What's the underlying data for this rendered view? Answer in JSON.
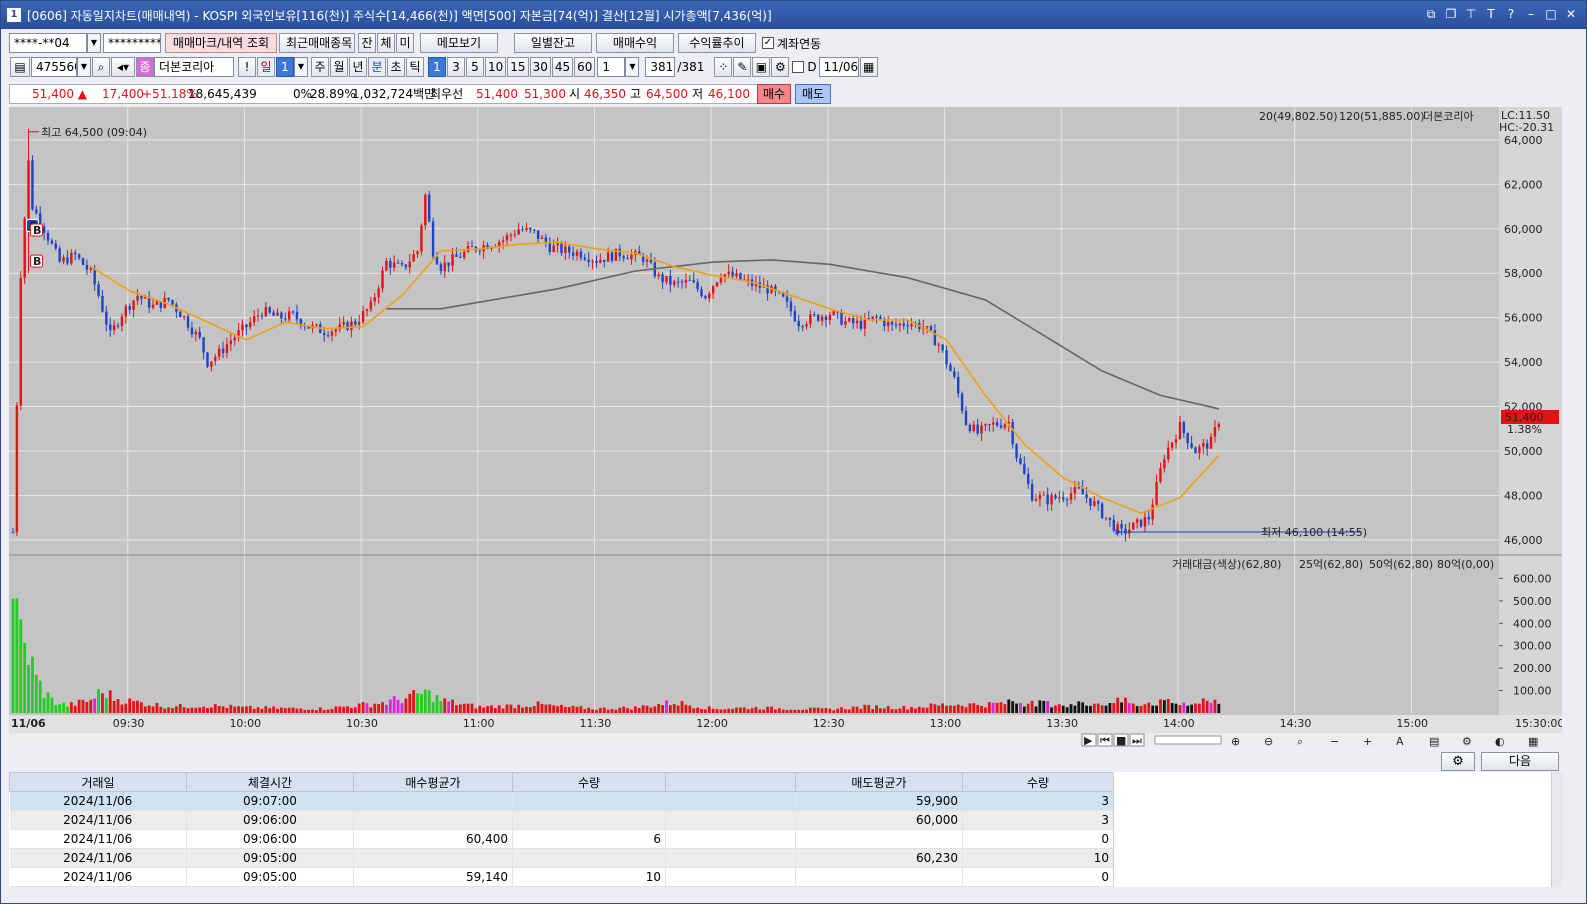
{
  "window": {
    "title": "[0606] 자동일지차트(매매내역) - KOSPI 외국인보유[116(천)] 주식수[14,466(천)] 액면[500] 자본금[74(억)] 결산[12월] 시가총액[7,436(억)]",
    "icon": "1"
  },
  "toolbar1": {
    "account": "****-**04",
    "password": "*********",
    "mark_query": "매매마크/내역 조회",
    "recent": "최근매매종목",
    "tabs": [
      "잔",
      "체",
      "미"
    ],
    "memo": "메모보기",
    "daily": "일별잔고",
    "profit": "매매수익",
    "return": "수익률추이",
    "link_label": "계좌연동"
  },
  "toolbar2": {
    "code": "475560",
    "name": "더본코리아",
    "name_icon": "종",
    "period_label": "일",
    "period_value": "1",
    "periods": [
      "주",
      "월",
      "년",
      "분",
      "초",
      "틱"
    ],
    "minutes": [
      "1",
      "3",
      "5",
      "10",
      "15",
      "30",
      "45",
      "60"
    ],
    "unit_value": "1",
    "count": "381",
    "total": "/381",
    "date_prefix": "D",
    "date": "11/06"
  },
  "quote": {
    "price": "51,400 ▲",
    "change": "17,400",
    "rate": "+51.18%",
    "volume": "18,645,439",
    "pct0": "0%",
    "turnover": "28.89%",
    "amount": "1,032,724백만",
    "best_label": "최우선",
    "ask": "51,400",
    "bid": "51,300",
    "open_label": "시",
    "open": "46,350",
    "high_label": "고",
    "high": "64,500",
    "low_label": "저",
    "low": "46,100",
    "buy": "매수",
    "sell": "매도"
  },
  "chart_data": {
    "type": "candlestick",
    "legend": {
      "ma20": "20(49,802.50)",
      "ma120": "120(51,885.00)",
      "name": "더본코리아",
      "lc": "LC:11.50",
      "hc": "HC:-20.31"
    },
    "colors": {
      "up": "#e01414",
      "down": "#1d44c8",
      "ma20": "#f0a010",
      "ma120": "#666666"
    },
    "y_ticks": [
      "64,000",
      "62,000",
      "60,000",
      "58,000",
      "56,000",
      "54,000",
      "52,000",
      "50,000",
      "48,000",
      "46,000"
    ],
    "ylim": [
      45500,
      65300
    ],
    "current_price": "51,400",
    "current_rate": "1.38%",
    "high_note": "최고 64,500 (09:04)",
    "low_note": "최저 46,100 (14:55)",
    "x_ticks": [
      "11/06",
      "09:30",
      "10:00",
      "10:30",
      "11:00",
      "11:30",
      "12:00",
      "12:30",
      "13:00",
      "13:30",
      "14:00",
      "14:30",
      "15:00",
      "15:30:00"
    ],
    "close_path": [
      [
        0,
        46350
      ],
      [
        2,
        58000
      ],
      [
        4,
        63000
      ],
      [
        5,
        61000
      ],
      [
        8,
        60000
      ],
      [
        12,
        58500
      ],
      [
        16,
        58800
      ],
      [
        20,
        58000
      ],
      [
        22,
        57000
      ],
      [
        25,
        55200
      ],
      [
        28,
        56200
      ],
      [
        32,
        57000
      ],
      [
        36,
        56500
      ],
      [
        40,
        56800
      ],
      [
        44,
        56000
      ],
      [
        48,
        55000
      ],
      [
        50,
        54000
      ],
      [
        53,
        54400
      ],
      [
        56,
        55000
      ],
      [
        60,
        55600
      ],
      [
        64,
        56300
      ],
      [
        68,
        56000
      ],
      [
        72,
        56100
      ],
      [
        76,
        55600
      ],
      [
        80,
        55400
      ],
      [
        84,
        55500
      ],
      [
        88,
        55800
      ],
      [
        92,
        56500
      ],
      [
        96,
        58500
      ],
      [
        100,
        58200
      ],
      [
        104,
        59000
      ],
      [
        106,
        61500
      ],
      [
        108,
        59000
      ],
      [
        110,
        58300
      ],
      [
        114,
        58700
      ],
      [
        118,
        59100
      ],
      [
        122,
        59300
      ],
      [
        126,
        59500
      ],
      [
        130,
        60000
      ],
      [
        134,
        59800
      ],
      [
        138,
        59200
      ],
      [
        142,
        59000
      ],
      [
        146,
        58900
      ],
      [
        150,
        58600
      ],
      [
        156,
        58900
      ],
      [
        162,
        58700
      ],
      [
        166,
        57800
      ],
      [
        170,
        57500
      ],
      [
        174,
        57600
      ],
      [
        178,
        57000
      ],
      [
        182,
        58000
      ],
      [
        186,
        57800
      ],
      [
        190,
        57500
      ],
      [
        194,
        57300
      ],
      [
        198,
        56800
      ],
      [
        202,
        55800
      ],
      [
        206,
        56000
      ],
      [
        210,
        56200
      ],
      [
        214,
        55800
      ],
      [
        218,
        55700
      ],
      [
        222,
        56000
      ],
      [
        226,
        55600
      ],
      [
        230,
        55800
      ],
      [
        234,
        55600
      ],
      [
        238,
        54800
      ],
      [
        242,
        53200
      ],
      [
        245,
        51300
      ],
      [
        248,
        50800
      ],
      [
        252,
        51200
      ],
      [
        256,
        51300
      ],
      [
        258,
        49800
      ],
      [
        262,
        48000
      ],
      [
        266,
        47800
      ],
      [
        270,
        48000
      ],
      [
        274,
        48200
      ],
      [
        278,
        47600
      ],
      [
        282,
        46800
      ],
      [
        285,
        46300
      ],
      [
        288,
        46600
      ],
      [
        292,
        47000
      ],
      [
        296,
        49800
      ],
      [
        300,
        51100
      ],
      [
        304,
        50000
      ],
      [
        308,
        50400
      ],
      [
        310,
        51400
      ]
    ],
    "ma20": [
      [
        20,
        58300
      ],
      [
        30,
        57200
      ],
      [
        40,
        56600
      ],
      [
        50,
        55800
      ],
      [
        60,
        55000
      ],
      [
        70,
        55800
      ],
      [
        80,
        55500
      ],
      [
        90,
        55600
      ],
      [
        100,
        57000
      ],
      [
        110,
        59000
      ],
      [
        120,
        59100
      ],
      [
        130,
        59300
      ],
      [
        140,
        59400
      ],
      [
        150,
        59100
      ],
      [
        160,
        58900
      ],
      [
        170,
        58300
      ],
      [
        180,
        57900
      ],
      [
        190,
        57600
      ],
      [
        200,
        57000
      ],
      [
        210,
        56400
      ],
      [
        220,
        55900
      ],
      [
        230,
        55900
      ],
      [
        240,
        55000
      ],
      [
        250,
        52500
      ],
      [
        260,
        50300
      ],
      [
        270,
        48800
      ],
      [
        280,
        47900
      ],
      [
        290,
        47200
      ],
      [
        300,
        47900
      ],
      [
        310,
        49800
      ]
    ],
    "ma120": [
      [
        96,
        56400
      ],
      [
        110,
        56400
      ],
      [
        120,
        56700
      ],
      [
        140,
        57300
      ],
      [
        160,
        58100
      ],
      [
        180,
        58500
      ],
      [
        195,
        58600
      ],
      [
        210,
        58400
      ],
      [
        230,
        57800
      ],
      [
        250,
        56800
      ],
      [
        265,
        55200
      ],
      [
        280,
        53600
      ],
      [
        295,
        52500
      ],
      [
        310,
        51900
      ]
    ],
    "trade_marks": [
      {
        "label": "S",
        "price": 60100
      },
      {
        "label": "B",
        "price": 59900
      },
      {
        "label": "B",
        "price": 58500
      }
    ],
    "volume_legend": {
      "main": "거래대금(색상)(62,80)",
      "b25": "25억(62,80)",
      "b50": "50억(62,80)",
      "b80": "80억(0,00)"
    },
    "volume_ticks": [
      "600.00",
      "500.00",
      "400.00",
      "300.00",
      "200.00",
      "100.00"
    ],
    "volume_ylim": [
      0,
      660
    ],
    "volume": [
      [
        0,
        650
      ],
      [
        1,
        420
      ],
      [
        2,
        380
      ],
      [
        3,
        300
      ],
      [
        4,
        280
      ],
      [
        5,
        220
      ],
      [
        6,
        160
      ],
      [
        7,
        130
      ],
      [
        8,
        100
      ],
      [
        9,
        80
      ],
      [
        10,
        60
      ],
      [
        11,
        50
      ],
      [
        12,
        45
      ],
      [
        13,
        40
      ],
      [
        14,
        35
      ],
      [
        20,
        60
      ],
      [
        22,
        90
      ],
      [
        24,
        95
      ],
      [
        26,
        70
      ],
      [
        30,
        55
      ],
      [
        40,
        30
      ],
      [
        50,
        35
      ],
      [
        60,
        25
      ],
      [
        70,
        22
      ],
      [
        80,
        20
      ],
      [
        96,
        50
      ],
      [
        98,
        60
      ],
      [
        100,
        65
      ],
      [
        104,
        85
      ],
      [
        106,
        95
      ],
      [
        108,
        80
      ],
      [
        110,
        60
      ],
      [
        114,
        45
      ],
      [
        120,
        28
      ],
      [
        130,
        35
      ],
      [
        135,
        40
      ],
      [
        140,
        30
      ],
      [
        150,
        20
      ],
      [
        160,
        25
      ],
      [
        170,
        50
      ],
      [
        180,
        20
      ],
      [
        190,
        25
      ],
      [
        200,
        20
      ],
      [
        210,
        18
      ],
      [
        220,
        30
      ],
      [
        230,
        25
      ],
      [
        240,
        40
      ],
      [
        250,
        40
      ],
      [
        258,
        50
      ],
      [
        262,
        45
      ],
      [
        270,
        40
      ],
      [
        280,
        45
      ],
      [
        285,
        55
      ],
      [
        290,
        45
      ],
      [
        296,
        50
      ],
      [
        300,
        45
      ],
      [
        305,
        50
      ],
      [
        310,
        60
      ]
    ]
  },
  "chart_toolbar": {
    "icons": [
      "play-icon",
      "rewind-icon",
      "stop-icon",
      "forward-icon",
      "zoom-out-icon",
      "zoom-in-icon",
      "text-icon"
    ]
  },
  "table": {
    "headers": [
      "거래일",
      "체결시간",
      "매수평균가",
      "수량",
      "",
      "매도평균가",
      "수량"
    ],
    "rows": [
      [
        "2024/11/06",
        "09:07:00",
        "",
        "",
        "",
        "59,900",
        "3"
      ],
      [
        "2024/11/06",
        "09:06:00",
        "",
        "",
        "",
        "60,000",
        "3"
      ],
      [
        "2024/11/06",
        "09:06:00",
        "60,400",
        "6",
        "",
        "",
        "0"
      ],
      [
        "2024/11/06",
        "09:05:00",
        "",
        "",
        "",
        "60,230",
        "10"
      ],
      [
        "2024/11/06",
        "09:05:00",
        "59,140",
        "10",
        "",
        "",
        "0"
      ]
    ],
    "next": "다음"
  }
}
